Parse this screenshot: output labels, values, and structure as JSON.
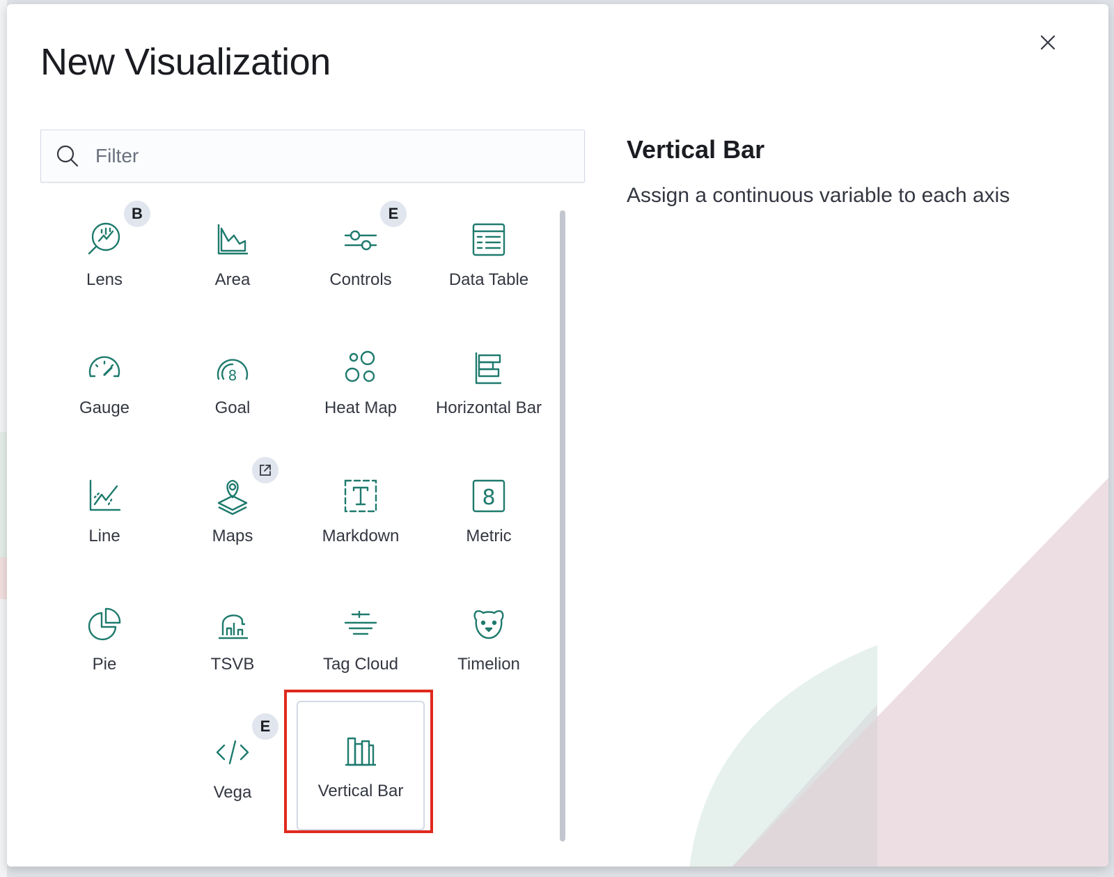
{
  "modal": {
    "title": "New Visualization",
    "close_label": "close"
  },
  "filter": {
    "placeholder": "Filter",
    "value": ""
  },
  "visualizations": [
    {
      "label": "Lens",
      "icon": "lens-icon",
      "badge": "B"
    },
    {
      "label": "Area",
      "icon": "area-chart-icon"
    },
    {
      "label": "Controls",
      "icon": "controls-icon",
      "badge": "E"
    },
    {
      "label": "Data Table",
      "icon": "data-table-icon"
    },
    {
      "label": "Gauge",
      "icon": "gauge-icon"
    },
    {
      "label": "Goal",
      "icon": "goal-icon"
    },
    {
      "label": "Heat Map",
      "icon": "heat-map-icon"
    },
    {
      "label": "Horizontal Bar",
      "icon": "horizontal-bar-icon"
    },
    {
      "label": "Line",
      "icon": "line-chart-icon"
    },
    {
      "label": "Maps",
      "icon": "maps-icon",
      "badge_icon": "external-link-icon"
    },
    {
      "label": "Markdown",
      "icon": "markdown-icon"
    },
    {
      "label": "Metric",
      "icon": "metric-icon"
    },
    {
      "label": "Pie",
      "icon": "pie-chart-icon"
    },
    {
      "label": "TSVB",
      "icon": "tsvb-icon"
    },
    {
      "label": "Tag Cloud",
      "icon": "tag-cloud-icon"
    },
    {
      "label": "Timelion",
      "icon": "timelion-icon"
    },
    {
      "label": "Vega",
      "icon": "vega-code-icon",
      "badge": "E"
    },
    {
      "label": "Vertical Bar",
      "icon": "vertical-bar-icon",
      "selected": true
    }
  ],
  "detail": {
    "title": "Vertical Bar",
    "description": "Assign a continuous variable to each axis"
  },
  "colors": {
    "icon": "#1e7a6d",
    "highlight": "#e0291e",
    "badge_bg": "#e0e5ee"
  }
}
